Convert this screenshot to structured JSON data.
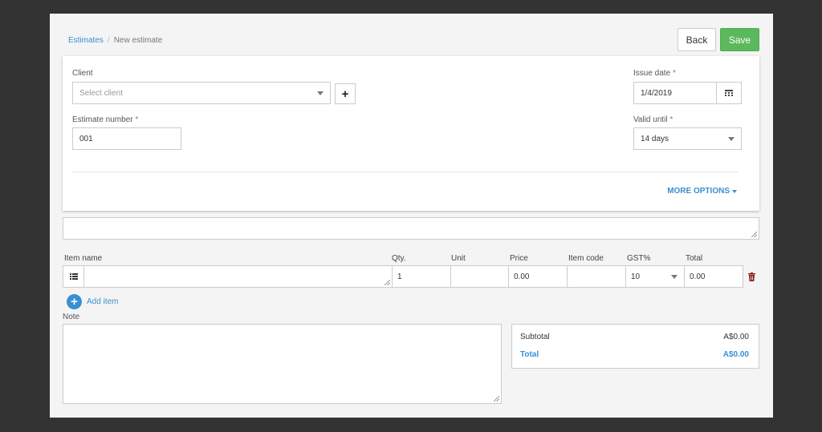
{
  "breadcrumb": {
    "parent": "Estimates",
    "separator": "/",
    "current": "New estimate"
  },
  "toolbar": {
    "back_label": "Back",
    "save_label": "Save"
  },
  "form": {
    "client_label": "Client",
    "client_placeholder": "Select client",
    "add_client_symbol": "+",
    "estimate_number_label": "Estimate number",
    "estimate_number_value": "001",
    "issue_date_label": "Issue date",
    "issue_date_value": "1/4/2019",
    "valid_until_label": "Valid until",
    "valid_until_value": "14 days",
    "required_marker": "*",
    "more_options_label": "MORE OPTIONS"
  },
  "items_table": {
    "headers": [
      "Item name",
      "Qty.",
      "Unit",
      "Price",
      "Item code",
      "GST%",
      "Total"
    ],
    "row": {
      "item_name": "",
      "qty": "1",
      "unit": "",
      "price": "0.00",
      "item_code": "",
      "gst": "10",
      "total": "0.00"
    },
    "add_item_label": "Add item"
  },
  "note": {
    "label": "Note"
  },
  "summary": {
    "subtotal_label": "Subtotal",
    "subtotal_value": "A$0.00",
    "total_label": "Total",
    "total_value": "A$0.00"
  },
  "colors": {
    "accent": "#3a8fd1",
    "save": "#5cb85c",
    "backdrop": "#333333",
    "page": "#f4f4f4",
    "delete_icon": "#8b1a1a"
  }
}
